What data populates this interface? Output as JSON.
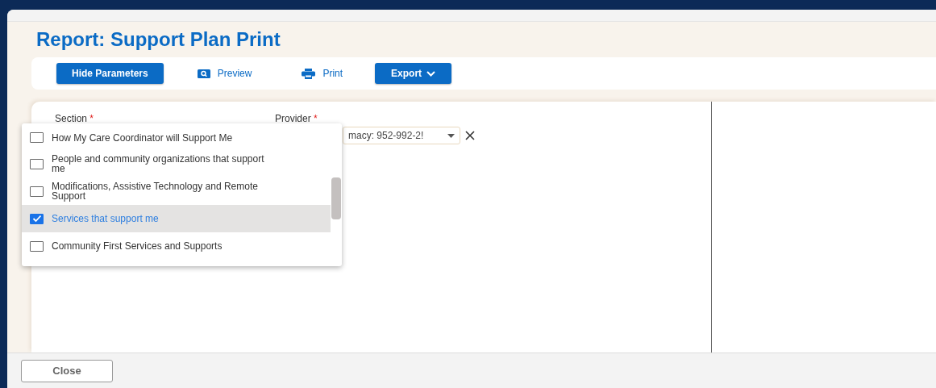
{
  "dialog": {
    "title": "Report: Support Plan Print"
  },
  "toolbar": [
    {
      "label": "Hide Parameters",
      "kind": "primary"
    },
    {
      "label": "Preview",
      "kind": "preview"
    },
    {
      "label": "Print",
      "kind": "print"
    },
    {
      "label": "Export",
      "kind": "dropdown"
    }
  ],
  "parameters": [
    {
      "label": "Section",
      "required_mark": "*"
    },
    {
      "label": "Provider",
      "required_mark": "*",
      "value": "macy: 952-992-2!"
    }
  ],
  "section_options": [
    {
      "label": "How My Care Coordinator will Support Me",
      "checked": false
    },
    {
      "label": "People and community organizations that support me",
      "checked": false
    },
    {
      "label": "Modifications, Assistive Technology and Remote Support",
      "checked": false
    },
    {
      "label": "Services that support me",
      "checked": true
    },
    {
      "label": "Community First Services and Supports",
      "checked": false
    }
  ],
  "footer": {
    "close": "Close"
  }
}
